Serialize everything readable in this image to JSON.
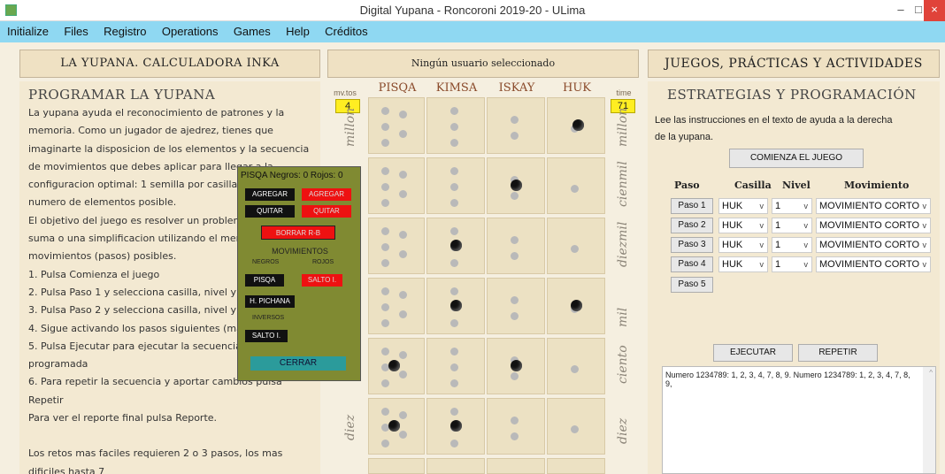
{
  "window": {
    "title": "Digital Yupana - Roncoroni 2019-20 - ULima",
    "minimize": "–",
    "maximize": "□",
    "close": "×"
  },
  "menu": [
    "Initialize",
    "Files",
    "Registro",
    "Operations",
    "Games",
    "Help",
    "Créditos"
  ],
  "left": {
    "header": "LA YUPANA. CALCULADORA INKA",
    "heading": "PROGRAMAR LA YUPANA",
    "lines": [
      "La yupana ayuda el reconocimiento de patrones y la",
      "memoria. Como un jugador de ajedrez, tienes que",
      "imaginarte la disposicion de los elementos y la secuencia",
      "de movimientos que debes aplicar para llegar a la",
      "configuracion optimal: 1 semilla por casilla y",
      "numero de elementos posible.",
      "El objetivo del juego es resolver un problem",
      "suma o una simplificacion utilizando el menor",
      "movimientos (pasos) posibles.",
      "1. Pulsa Comienza el juego",
      "2. Pulsa Paso 1 y selecciona casilla, nivel y m",
      "3. Pulsa Paso 2 y selecciona casilla, nivel y m",
      "4. Sigue activando los pasos siguientes (ma",
      "5. Pulsa Ejecutar para ejecutar la secuencia",
      "programada",
      "6. Para repetir la secuencia y aportar cambios pulsa",
      "Repetir",
      "Para ver el reporte final pulsa Reporte.",
      "",
      "Los retos mas faciles requieren 2 o 3 pasos, los mas",
      "dificiles hasta 7"
    ]
  },
  "center": {
    "header": "Ningún usuario seleccionado",
    "mvtos_label": "mv.tos",
    "mvtos_value": "4",
    "time_label": "time",
    "time_value": "71",
    "columns": [
      "PISQA",
      "KIMSA",
      "ISKAY",
      "HUK"
    ],
    "row_labels": [
      "millon",
      "cienmil",
      "diezmil",
      "mil",
      "ciento",
      "diez"
    ]
  },
  "popup": {
    "title": "PISQA  Negros: 0 Rojos: 0",
    "agregar_black": "AGREGAR",
    "agregar_red": "AGREGAR",
    "quitar_black": "QUITAR",
    "quitar_red": "QUITAR",
    "borrar": "BORRAR R-B",
    "movimientos": "MOVIMIENTOS",
    "negros": "NEGROS",
    "rojos": "ROJOS",
    "pisqa": "PISQA",
    "salto_red": "SALTO I.",
    "h_pichana": "H. PICHANA",
    "inversos": "INVERSOS",
    "salto_black": "SALTO I.",
    "cerrar": "CERRAR"
  },
  "right": {
    "header": "JUEGOS, PRÁCTICAS Y ACTIVIDADES",
    "heading": "ESTRATEGIAS Y PROGRAMACIÓN",
    "instructions": [
      "Lee las instrucciones en el texto de ayuda a la derecha",
      "de la yupana."
    ],
    "start_button": "COMIENZA EL JUEGO",
    "col_paso": "Paso",
    "col_casilla": "Casilla",
    "col_nivel": "Nivel",
    "col_movimiento": "Movimiento",
    "steps": [
      {
        "label": "Paso 1",
        "casilla": "HUK",
        "nivel": "1",
        "movimiento": "MOVIMIENTO CORTO"
      },
      {
        "label": "Paso 2",
        "casilla": "HUK",
        "nivel": "1",
        "movimiento": "MOVIMIENTO CORTO"
      },
      {
        "label": "Paso 3",
        "casilla": "HUK",
        "nivel": "1",
        "movimiento": "MOVIMIENTO CORTO"
      },
      {
        "label": "Paso 4",
        "casilla": "HUK",
        "nivel": "1",
        "movimiento": "MOVIMIENTO CORTO"
      },
      {
        "label": "Paso 5"
      }
    ],
    "ejecutar": "EJECUTAR",
    "repetir": "REPETIR",
    "output": "Numero 1234789: 1, 2, 3, 4, 7, 8, 9. Numero 1234789: 1, 2, 3, 4, 7, 8, 9,"
  },
  "colors": {
    "menu_bg": "#8fd8f2",
    "mvtos_bg": "#ffee22",
    "popup_bg": "#808a32",
    "red_button": "#ee1111",
    "teal_button": "#2b9b9b"
  }
}
